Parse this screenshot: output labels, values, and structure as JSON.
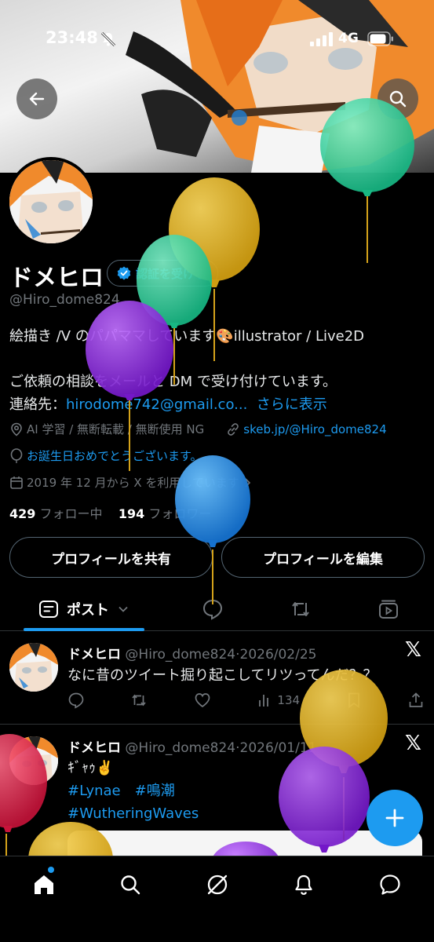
{
  "status_bar": {
    "time": "23:48",
    "network": "4G",
    "icons": [
      "bell-muted-icon",
      "signal-icon",
      "battery-icon"
    ]
  },
  "header": {
    "back_icon": "arrow-left-icon",
    "search_icon": "search-icon"
  },
  "profile": {
    "display_name": "ドメヒロ",
    "verify_button": "認証を受ける",
    "handle": "@Hiro_dome824",
    "bio_line1": "絵描き /V のパパママしています🎨illustrator / Live2D",
    "bio_line2": "ご依頼の相談をメールと DM で受け付けています。",
    "contact_label": "連絡先：",
    "contact_email": "hirodome742@gmail.co...",
    "show_more": "さらに表示",
    "notice": "AI 学習 / 無断転載 / 無断使用 NG",
    "website": "skeb.jp/@Hiro_dome824",
    "birthday": "お誕生日おめでとうございます。",
    "joined": "2019 年 12 月から X を利用しています",
    "following_count": "429",
    "following_label": "フォロー中",
    "followers_count": "194",
    "followers_label": "フォロワー"
  },
  "actions": {
    "share": "プロフィールを共有",
    "edit": "プロフィールを編集"
  },
  "tabs": {
    "posts": "ポスト"
  },
  "posts": [
    {
      "name": "ドメヒロ",
      "handle": "@Hiro_dome824",
      "date": "2026/02/25",
      "text": "なに昔のツイート掘り起こしてリツってんだ？？",
      "views": "134"
    },
    {
      "name": "ドメヒロ",
      "handle": "@Hiro_dome824",
      "date": "2026/01/11",
      "text": "ｷﾞｬｩ✌️",
      "tags_line1": "#Lynae　#鳴潮",
      "tags_line2": "#WutheringWaves"
    }
  ],
  "colors": {
    "accent": "#1d9bf0",
    "background": "#000000",
    "muted": "#71767b"
  }
}
